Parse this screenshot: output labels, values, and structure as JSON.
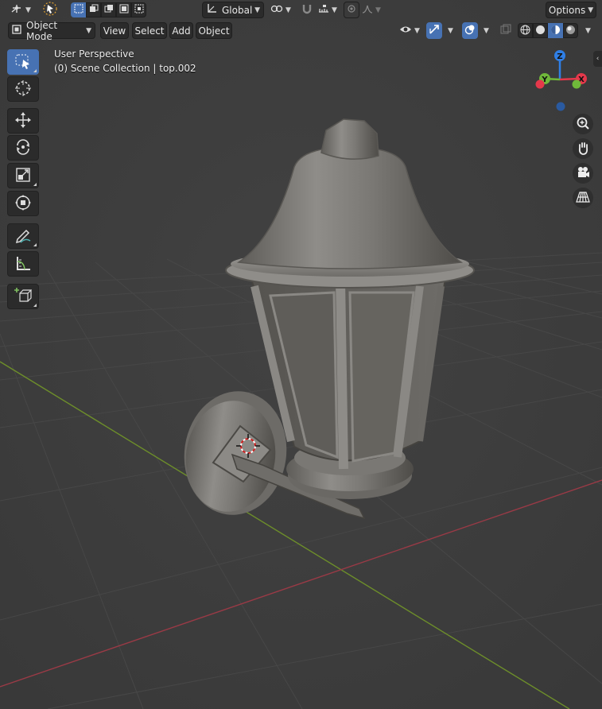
{
  "header_top": {
    "transform_orientation": "Global",
    "options_label": "Options"
  },
  "header_second": {
    "mode_label": "Object Mode",
    "menus": [
      "View",
      "Select",
      "Add",
      "Object"
    ]
  },
  "viewport": {
    "perspective_label": "User Perspective",
    "collection_label": "(0) Scene Collection | top.002"
  },
  "gizmo": {
    "axis_z": "Z",
    "axis_y": "Y",
    "axis_x": "X",
    "colors": {
      "x": "#e5384b",
      "y": "#6fb83a",
      "z": "#2f7fe6",
      "neg": "#2a5aa0"
    }
  },
  "toolbar": {
    "tools": [
      "select-box",
      "cursor",
      "move",
      "rotate",
      "scale",
      "transform",
      "annotate",
      "measure",
      "add-cube"
    ],
    "active_tool": "select-box"
  },
  "nav": [
    "zoom",
    "pan",
    "camera",
    "perspective-grid"
  ],
  "colors": {
    "accent": "#4772b3",
    "background": "#3d3d3d",
    "grid_x_axis": "#9a3a46",
    "grid_y_axis": "#6d8e2a"
  }
}
